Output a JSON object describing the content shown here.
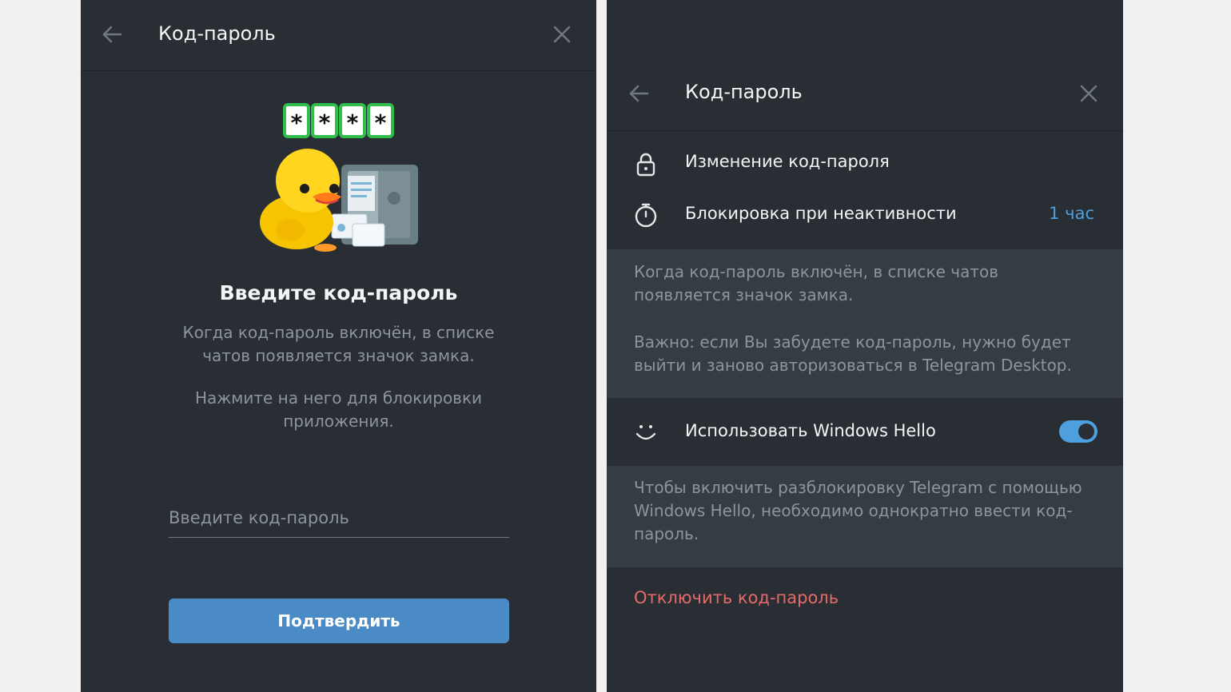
{
  "left": {
    "title": "Код-пароль",
    "heading": "Введите код-пароль",
    "description": "Когда код-пароль включён, в списке чатов появляется значок замка.",
    "hint": "Нажмите на него для блокировки приложения.",
    "input_placeholder": "Введите код-пароль",
    "confirm_label": "Подтвердить",
    "sticker_stars": [
      "*",
      "*",
      "*",
      "*"
    ]
  },
  "right": {
    "title": "Код-пароль",
    "change_label": "Изменение код-пароля",
    "autolock_label": "Блокировка при неактивности",
    "autolock_value": "1 час",
    "info_1": "Когда код-пароль включён, в списке чатов появляется значок замка.",
    "info_2": "Важно: если Вы забудете код-пароль, нужно будет выйти и заново авторизоваться в Telegram Desktop.",
    "hello_label": "Использовать Windows Hello",
    "hello_enabled": true,
    "hello_info": "Чтобы включить разблокировку Telegram с помощью Windows Hello, необходимо однократно ввести код-пароль.",
    "disable_label": "Отключить код-пароль"
  },
  "colors": {
    "panel_bg": "#282e33",
    "info_bg": "#353d44",
    "accent": "#4d9fde",
    "button": "#4a8bc5",
    "danger": "#e76a6a",
    "muted_text": "#8d959b"
  },
  "icons": [
    "back-arrow-icon",
    "close-icon",
    "lock-icon",
    "timer-icon",
    "smile-icon",
    "duck-sticker"
  ]
}
